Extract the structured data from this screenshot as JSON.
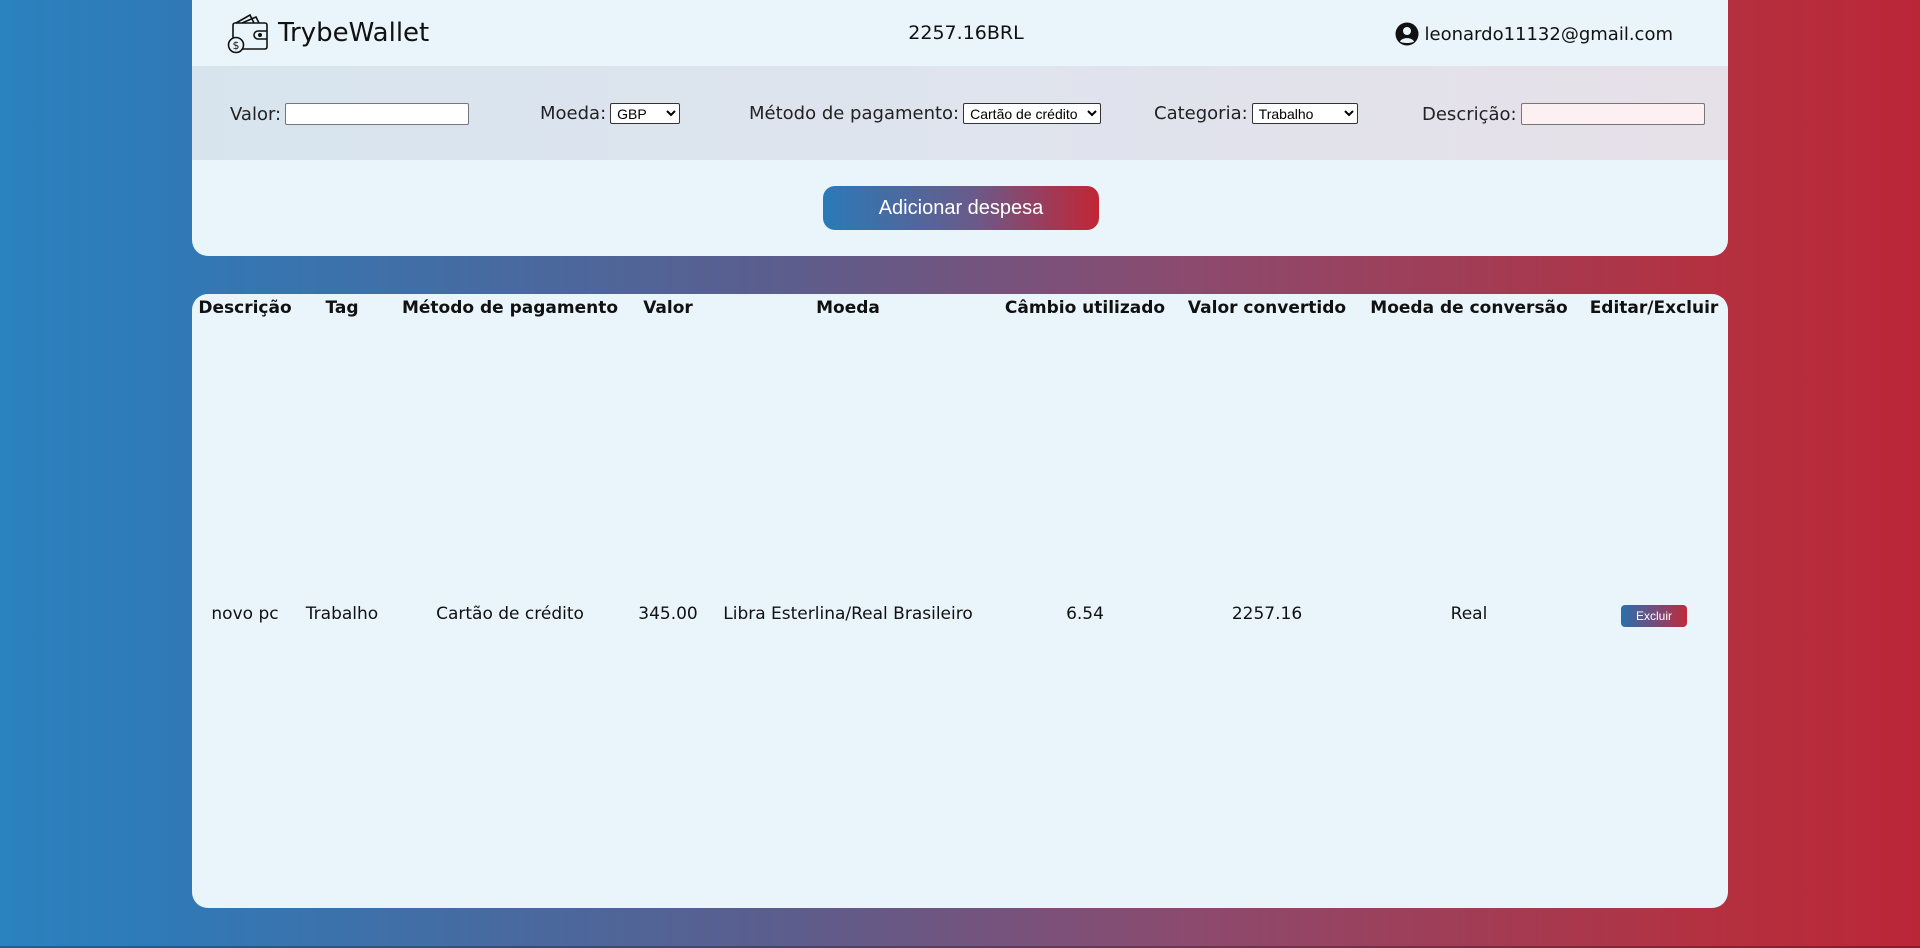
{
  "header": {
    "app_name": "TrybeWallet",
    "total": "2257.16BRL",
    "user_email": "leonardo11132@gmail.com"
  },
  "form": {
    "valor_label": "Valor:",
    "valor_value": "",
    "moeda_label": "Moeda:",
    "moeda_selected": "GBP",
    "metodo_label": "Método de pagamento:",
    "metodo_selected": "Cartão de crédito",
    "categoria_label": "Categoria:",
    "categoria_selected": "Trabalho",
    "descricao_label": "Descrição:",
    "descricao_value": "",
    "add_button": "Adicionar despesa"
  },
  "table": {
    "headers": [
      "Descrição",
      "Tag",
      "Método de pagamento",
      "Valor",
      "Moeda",
      "Câmbio utilizado",
      "Valor convertido",
      "Moeda de conversão",
      "Editar/Excluir"
    ],
    "rows": [
      {
        "descricao": "novo pc",
        "tag": "Trabalho",
        "metodo": "Cartão de crédito",
        "valor": "345.00",
        "moeda": "Libra Esterlina/Real Brasileiro",
        "cambio": "6.54",
        "valor_convertido": "2257.16",
        "moeda_conversao": "Real",
        "delete_label": "Excluir"
      }
    ]
  },
  "icons": {
    "logo": "wallet-icon",
    "user": "user-circle-icon"
  }
}
